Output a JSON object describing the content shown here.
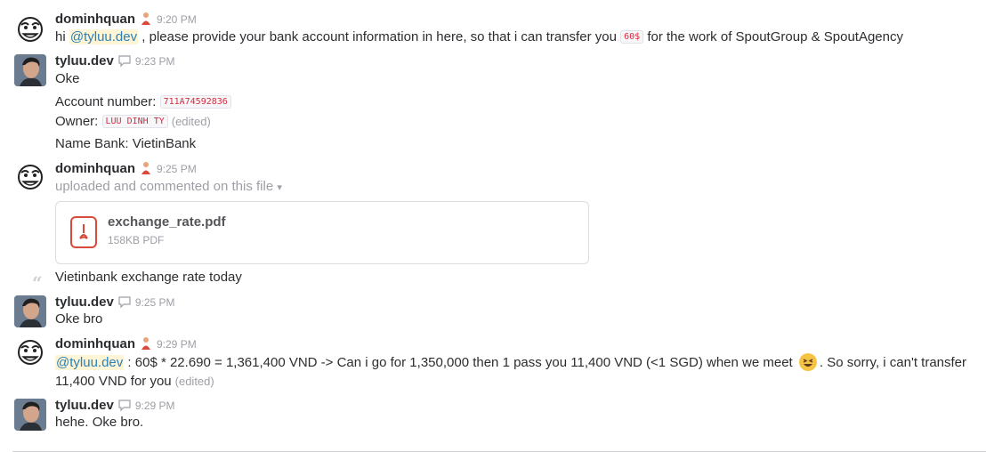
{
  "messages": [
    {
      "user": "dominhquan",
      "time": "9:20 PM"
    },
    {
      "user": "tyluu.dev",
      "time": "9:23 PM"
    },
    {
      "user": "dominhquan",
      "time": "9:25 PM"
    },
    {
      "user": "tyluu.dev",
      "time": "9:25 PM"
    },
    {
      "user": "dominhquan",
      "time": "9:29 PM"
    },
    {
      "user": "tyluu.dev",
      "time": "9:29 PM"
    }
  ],
  "m1": {
    "pre": "hi ",
    "mention": "@tyluu.dev",
    "mid": " , please provide your bank account information in here, so that i can transfer you ",
    "code": "60$",
    "post": " for the work of SpoutGroup & SpoutAgency"
  },
  "m2": {
    "line1": "Oke",
    "account_label": "Account number: ",
    "account_value": "711A74592836",
    "owner_label": "Owner: ",
    "owner_value": "LUU DINH TY",
    "edited": "(edited)",
    "bank": "Name Bank: VietinBank"
  },
  "m3": {
    "meta": "uploaded and commented on this file",
    "dropdown_glyph": "▾",
    "file_name": "exchange_rate.pdf",
    "file_size": "158KB PDF",
    "comment": "Vietinbank exchange rate today",
    "quote_glyph": "“"
  },
  "m4": {
    "text": "Oke bro"
  },
  "m5": {
    "mention": "@tyluu.dev",
    "text1": " : 60$ * 22.690 = 1,361,400 VND -> Can i go for 1,350,000 then 1 pass you 11,400 VND (<1 SGD) when we meet ",
    "text2": ". So sorry, i can't transfer",
    "line2": "11,400 VND for you",
    "edited": "(edited)",
    "emoji": "laughing-emoji"
  },
  "m6": {
    "text": "hehe. Oke bro."
  },
  "colors": {
    "mention": "#2a80b9",
    "mention_bg": "#fdf5d6",
    "code": "#d72b3f",
    "pdf": "#d84b3a",
    "muted": "#9e9ea6"
  }
}
